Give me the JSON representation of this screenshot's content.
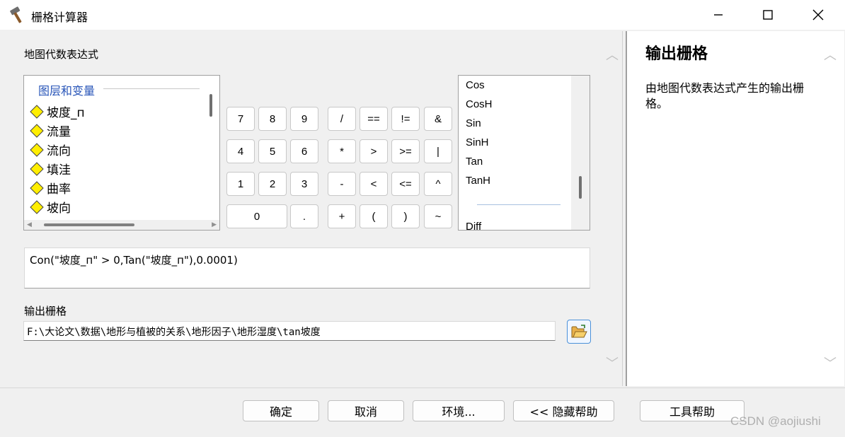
{
  "window": {
    "title": "栅格计算器",
    "app_icon": "hammer-icon"
  },
  "main": {
    "expression_label": "地图代数表达式",
    "layers": {
      "group_label": "图层和变量",
      "items": [
        "坡度_п",
        "流量",
        "流向",
        "填洼",
        "曲率",
        "坡向"
      ],
      "item_icon": "raster-layer-diamond-icon"
    },
    "calculator_buttons": {
      "row1": [
        "7",
        "8",
        "9",
        "/",
        "==",
        "!=",
        "&"
      ],
      "row2": [
        "4",
        "5",
        "6",
        "*",
        ">",
        ">=",
        "|"
      ],
      "row3": [
        "1",
        "2",
        "3",
        "-",
        "<",
        "<=",
        "^"
      ],
      "row4": [
        "0",
        ".",
        "+",
        "(",
        ")",
        "~"
      ]
    },
    "functions": [
      "Cos",
      "CosH",
      "Sin",
      "SinH",
      "Tan",
      "TanH",
      "Diff"
    ],
    "expression": "Con(\"坡度_п\" > 0,Tan(\"坡度_п\"),0.0001)",
    "output_label": "输出栅格",
    "output_path": "F:\\大论文\\数据\\地形与植被的关系\\地形因子\\地形湿度\\tan坡度",
    "browse_icon": "open-folder-icon"
  },
  "help": {
    "title": "输出栅格",
    "text": "由地图代数表达式产生的输出栅格。"
  },
  "footer": {
    "ok": "确定",
    "cancel": "取消",
    "environments": "环境...",
    "hide_help": "<< 隐藏帮助",
    "tool_help": "工具帮助"
  },
  "watermark": "CSDN @aojiushi",
  "colors": {
    "group_label": "#2855b8",
    "layer_diamond": "#ffee00",
    "browse_border": "#4a90d9"
  }
}
